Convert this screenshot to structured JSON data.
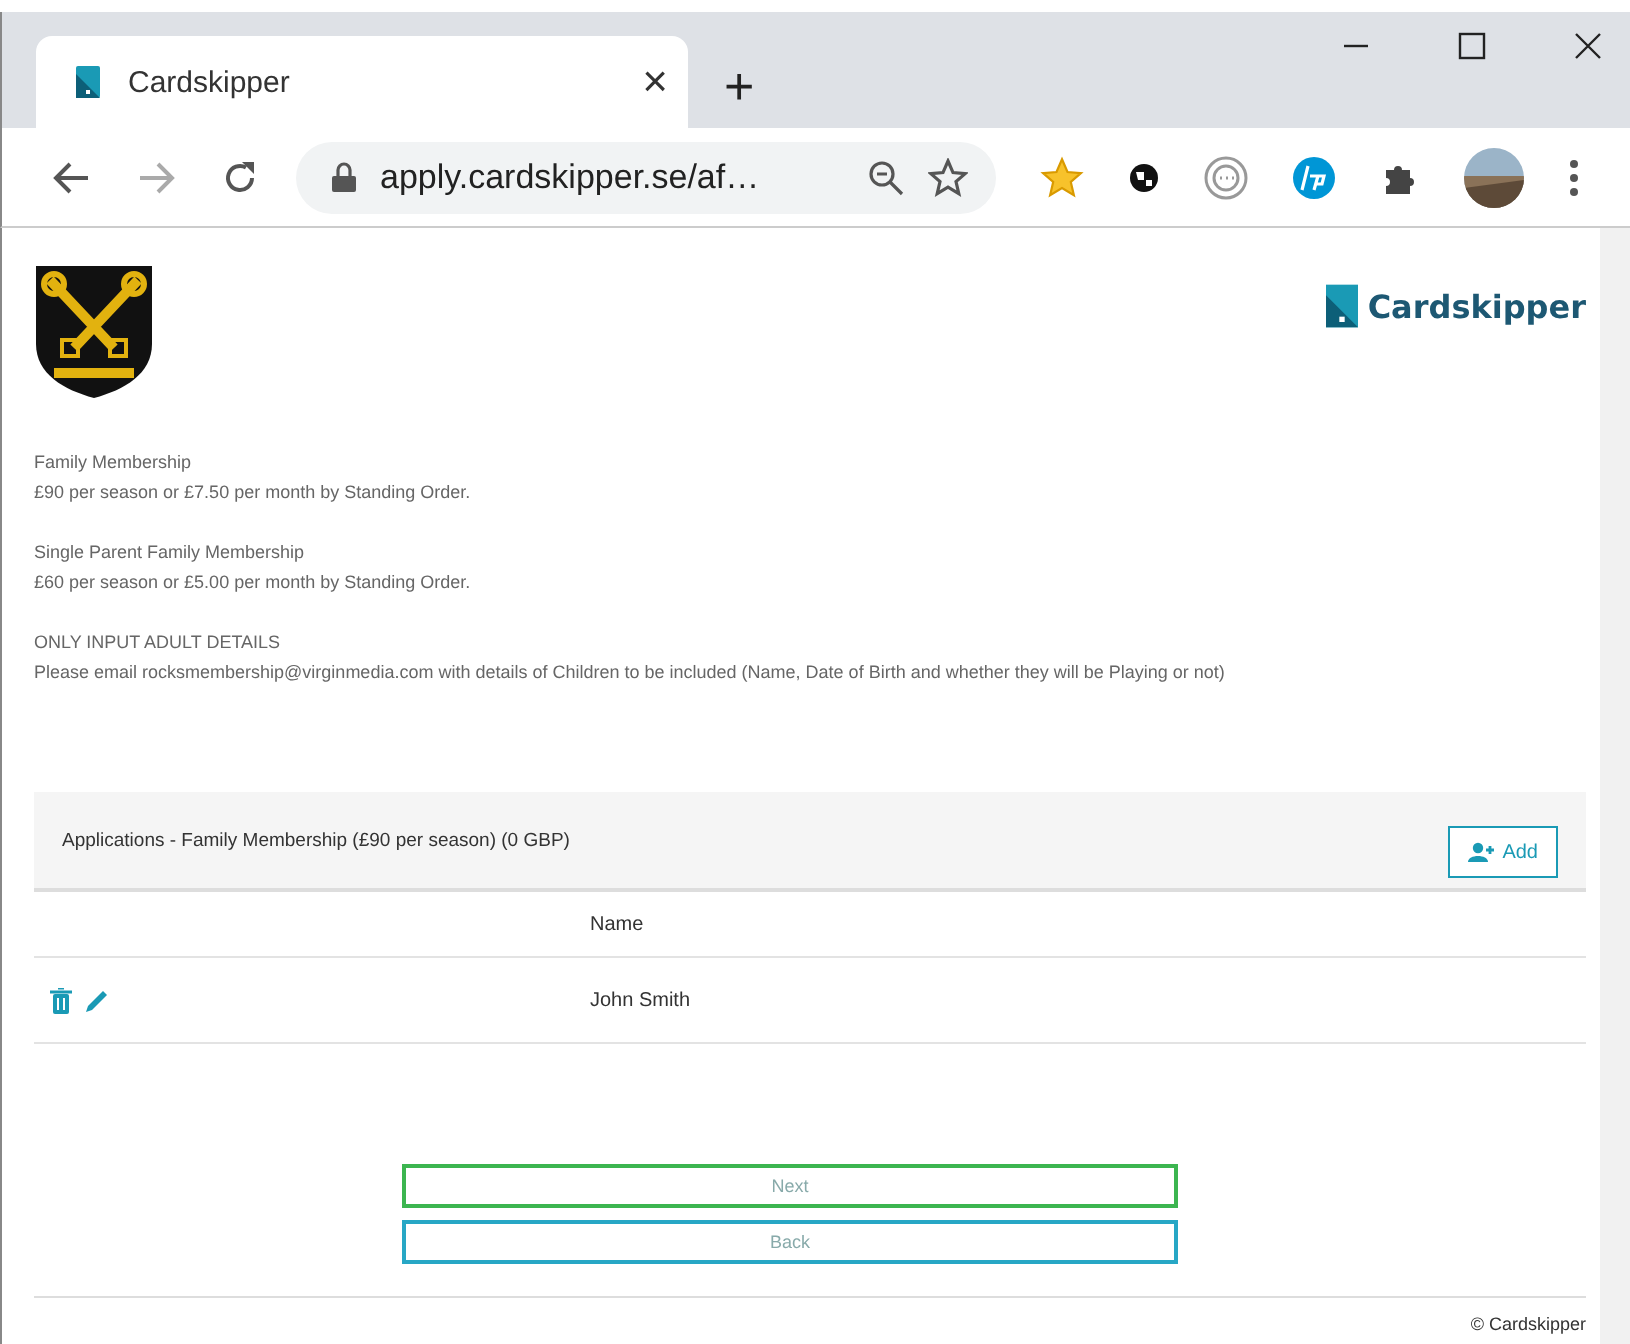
{
  "browser": {
    "tab_title": "Cardskipper",
    "close_tab": "×",
    "new_tab": "+",
    "url": "apply.cardskipper.se/af…"
  },
  "header": {
    "brand": "Cardskipper"
  },
  "info": [
    {
      "title": "Family Membership",
      "text": "£90 per season or £7.50 per month by Standing Order."
    },
    {
      "title": "Single Parent Family Membership",
      "text": "£60 per season or £5.00 per month by Standing Order."
    },
    {
      "title": "ONLY INPUT ADULT DETAILS",
      "text": "Please email rocksmembership@virginmedia.com with details of Children to be included (Name, Date of Birth and whether they will be Playing or not)"
    }
  ],
  "applications": {
    "title": "Applications - Family Membership (£90 per season) (0 GBP)",
    "add_button": "Add",
    "columns": [
      "Name"
    ],
    "rows": [
      {
        "name": "John Smith"
      }
    ]
  },
  "buttons": [
    {
      "label": "Next",
      "kind": "primary"
    },
    {
      "label": "Back",
      "kind": "secondary"
    }
  ],
  "footer": "© Cardskipper"
}
